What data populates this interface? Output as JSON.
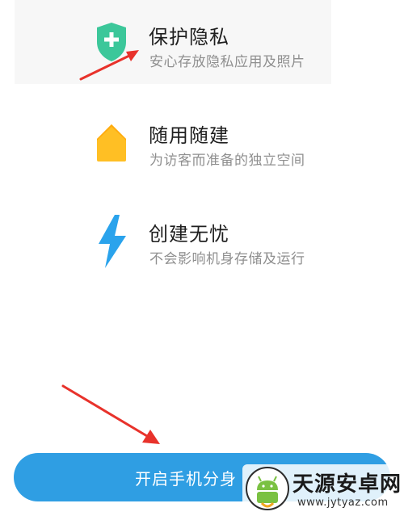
{
  "features": [
    {
      "title": "保护隐私",
      "subtitle": "安心存放隐私应用及照片",
      "icon": "shield-plus-icon",
      "color": "#3cc79a"
    },
    {
      "title": "随用随建",
      "subtitle": "为访客而准备的独立空间",
      "icon": "house-icon",
      "color": "#ffbf24"
    },
    {
      "title": "创建无忧",
      "subtitle": "不会影响机身存储及运行",
      "icon": "lightning-icon",
      "color": "#2aa3ec"
    }
  ],
  "button": {
    "label": "开启手机分身",
    "color": "#2f9ee3"
  },
  "watermark": {
    "name": "天源安卓网",
    "url": "www.jytyaz.com"
  },
  "annotation_color": "#e8322b"
}
